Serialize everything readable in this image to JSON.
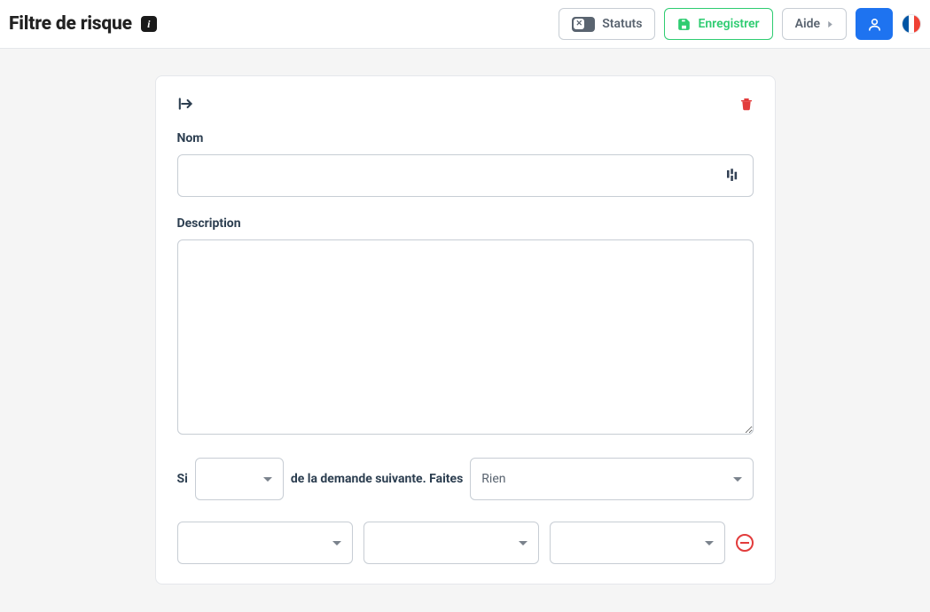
{
  "header": {
    "title": "Filtre de risque",
    "info_tooltip": "i",
    "statuts_label": "Statuts",
    "save_label": "Enregistrer",
    "help_label": "Aide",
    "locale_flag": "FR"
  },
  "form": {
    "name_label": "Nom",
    "name_value": "",
    "description_label": "Description",
    "description_value": "",
    "condition": {
      "if_label": "Si",
      "quantifier_options": [],
      "quantifier_selected": "",
      "middle_text": "de la demande suivante. Faites",
      "action_options": [
        "Rien"
      ],
      "action_selected": "Rien"
    },
    "subcondition": {
      "select1": "",
      "select2": "",
      "select3": ""
    }
  },
  "icons": {
    "expand": "expand-horizontal-icon",
    "trash": "trash-icon",
    "translate": "translate-bars-icon",
    "remove": "remove-circle-icon"
  }
}
